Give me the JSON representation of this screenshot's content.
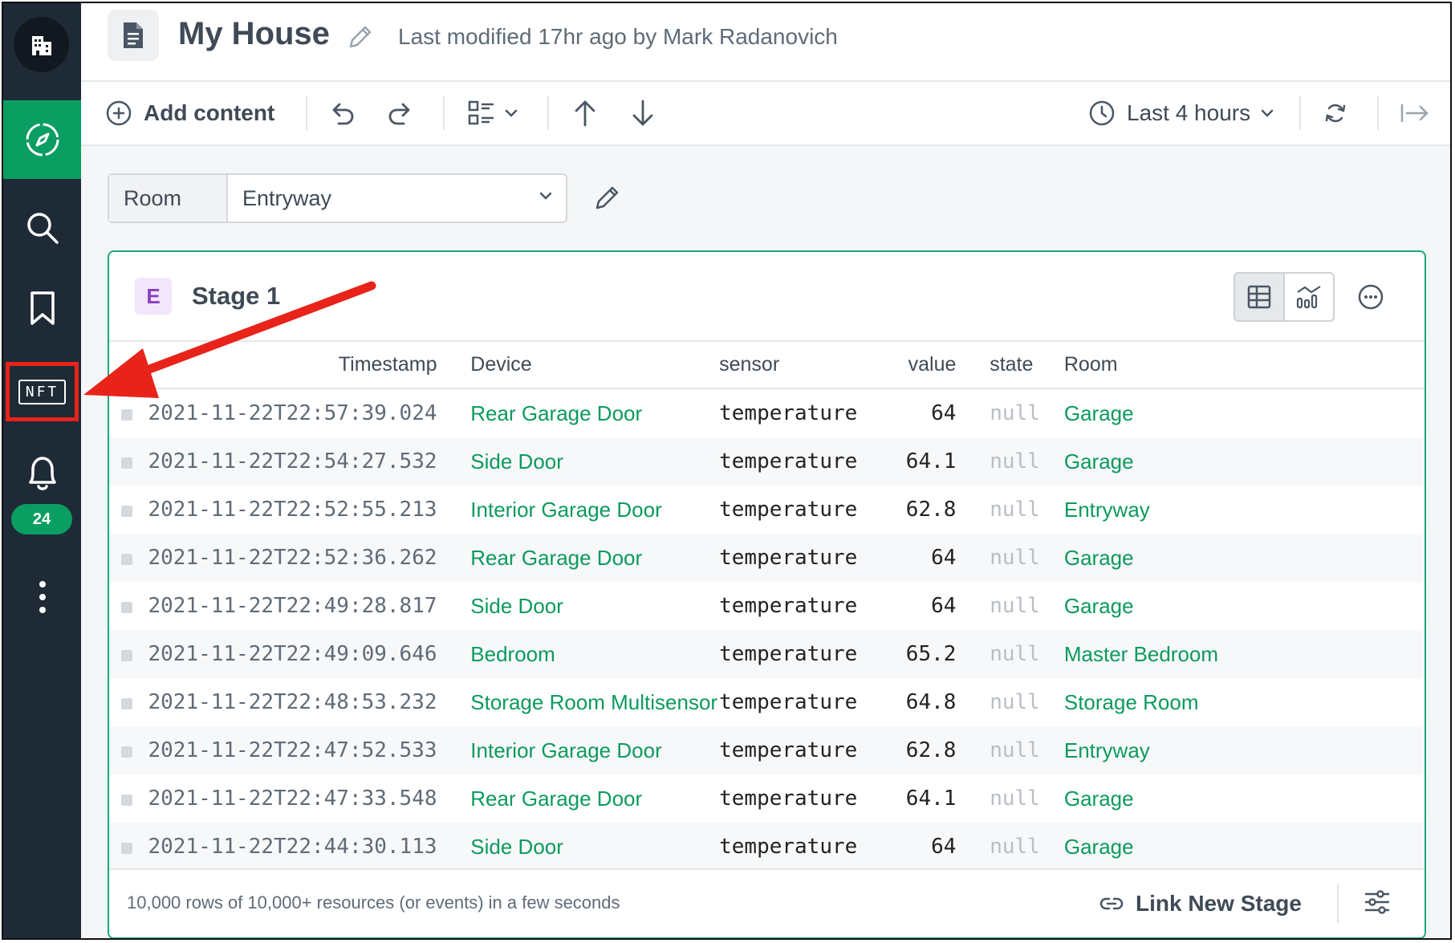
{
  "sidebar": {
    "nft_label": "NFT",
    "notification_count": "24",
    "colors": {
      "background": "#1f2a37",
      "active": "#0a9e62",
      "highlight": "#e8231a"
    }
  },
  "header": {
    "title": "My House",
    "subtitle": "Last modified 17hr ago by Mark Radanovich"
  },
  "toolbar": {
    "add_content_label": "Add content",
    "time_range_label": "Last 4 hours"
  },
  "filter": {
    "label": "Room",
    "value": "Entryway"
  },
  "stage": {
    "badge": "E",
    "title": "Stage 1",
    "columns": [
      "Timestamp",
      "Device",
      "sensor",
      "value",
      "state",
      "Room"
    ],
    "rows": [
      {
        "timestamp": "2021-11-22T22:57:39.024",
        "device": "Rear Garage Door",
        "sensor": "temperature",
        "value": "64",
        "state": "null",
        "room": "Garage"
      },
      {
        "timestamp": "2021-11-22T22:54:27.532",
        "device": "Side Door",
        "sensor": "temperature",
        "value": "64.1",
        "state": "null",
        "room": "Garage"
      },
      {
        "timestamp": "2021-11-22T22:52:55.213",
        "device": "Interior Garage Door",
        "sensor": "temperature",
        "value": "62.8",
        "state": "null",
        "room": "Entryway"
      },
      {
        "timestamp": "2021-11-22T22:52:36.262",
        "device": "Rear Garage Door",
        "sensor": "temperature",
        "value": "64",
        "state": "null",
        "room": "Garage"
      },
      {
        "timestamp": "2021-11-22T22:49:28.817",
        "device": "Side Door",
        "sensor": "temperature",
        "value": "64",
        "state": "null",
        "room": "Garage"
      },
      {
        "timestamp": "2021-11-22T22:49:09.646",
        "device": "Bedroom",
        "sensor": "temperature",
        "value": "65.2",
        "state": "null",
        "room": "Master Bedroom"
      },
      {
        "timestamp": "2021-11-22T22:48:53.232",
        "device": "Storage Room Multisensor",
        "sensor": "temperature",
        "value": "64.8",
        "state": "null",
        "room": "Storage Room"
      },
      {
        "timestamp": "2021-11-22T22:47:52.533",
        "device": "Interior Garage Door",
        "sensor": "temperature",
        "value": "62.8",
        "state": "null",
        "room": "Entryway"
      },
      {
        "timestamp": "2021-11-22T22:47:33.548",
        "device": "Rear Garage Door",
        "sensor": "temperature",
        "value": "64.1",
        "state": "null",
        "room": "Garage"
      },
      {
        "timestamp": "2021-11-22T22:44:30.113",
        "device": "Side Door",
        "sensor": "temperature",
        "value": "64",
        "state": "null",
        "room": "Garage"
      }
    ],
    "footer_text": "10,000 rows of 10,000+ resources (or events) in a few seconds",
    "link_stage_label": "Link New Stage"
  }
}
